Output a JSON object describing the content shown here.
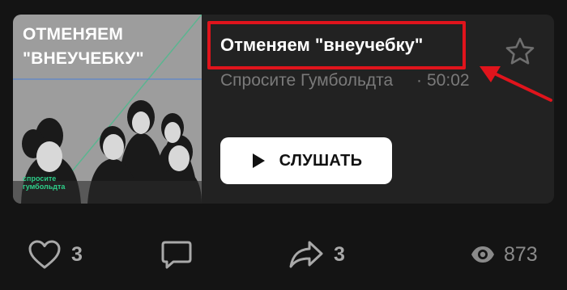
{
  "post": {
    "cover": {
      "title": "ОТМЕНЯЕМ\n\"ВНЕУЧЕБКУ\"",
      "logo_text": "спросите\nгумбольдта"
    },
    "episode": {
      "title": "Отменяем \"внеучебку\"",
      "author": "Спросите Гумбольдта",
      "duration": "50:02"
    },
    "listen_button": {
      "label": "СЛУШАТЬ"
    },
    "actions": {
      "likes": "3",
      "shares": "3",
      "views": "873"
    }
  },
  "colors": {
    "background": "#141414",
    "card": "#222222",
    "highlight": "#e0141c",
    "icon": "#a9a9a9"
  },
  "icons": [
    "star-icon",
    "play-icon",
    "heart-icon",
    "comment-icon",
    "share-icon",
    "eye-icon"
  ]
}
